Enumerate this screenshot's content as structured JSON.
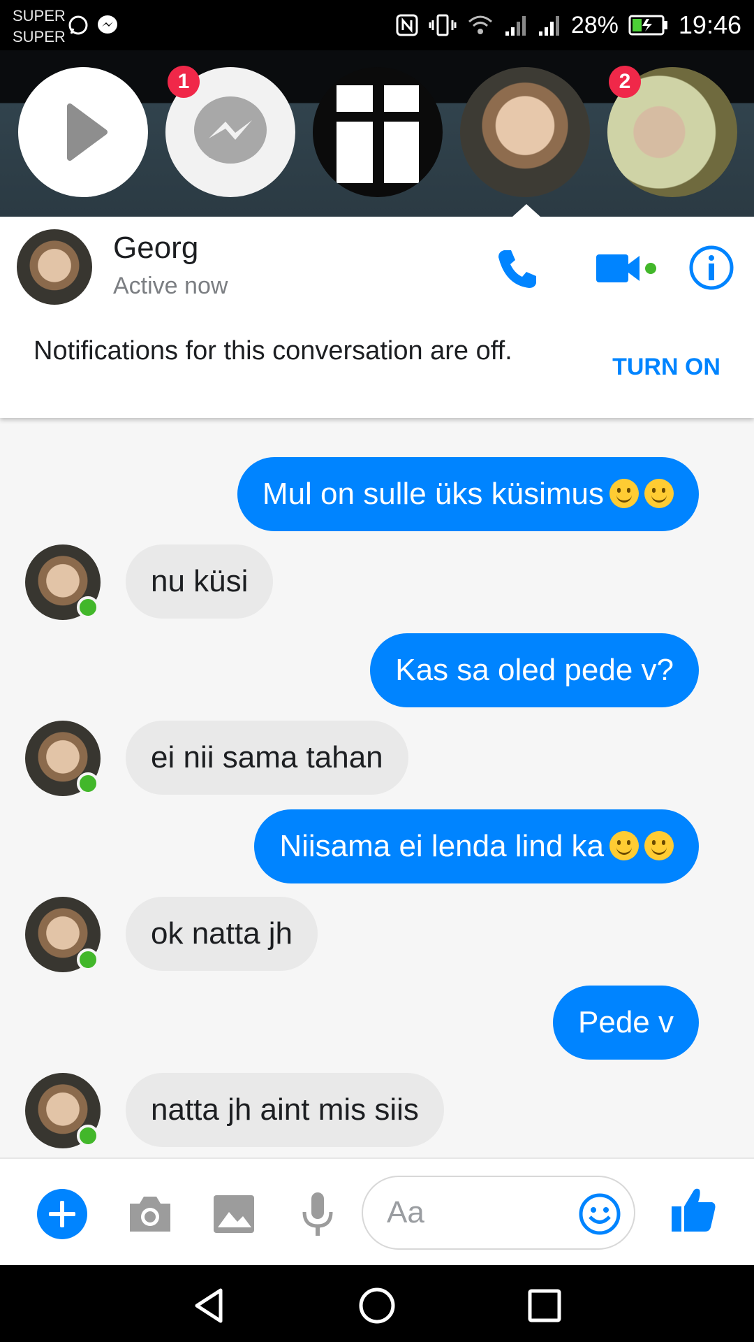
{
  "status_bar": {
    "carrier_line1": "SUPER",
    "carrier_line2": "SUPER",
    "battery_percent": "28%",
    "time": "19:46",
    "icons": [
      "whatsapp-icon",
      "messenger-icon",
      "nfc-icon",
      "vibrate-icon",
      "wifi-icon",
      "signal-icon",
      "signal-icon",
      "battery-icon"
    ]
  },
  "chat_heads": {
    "items": [
      {
        "name": "play",
        "badge": ""
      },
      {
        "name": "messenger",
        "badge": "1"
      },
      {
        "name": "cross",
        "badge": ""
      },
      {
        "name": "georg",
        "badge": ""
      },
      {
        "name": "contact",
        "badge": "2"
      }
    ]
  },
  "conversation": {
    "name": "Georg",
    "status": "Active now",
    "notification_text": "Notifications for this conversation are off.",
    "notification_action": "TURN ON",
    "colors": {
      "accent": "#0084ff",
      "online": "#42b72a",
      "incoming_bubble": "#e9e9e9"
    }
  },
  "messages": [
    {
      "dir": "in",
      "text": "",
      "emojis": 0
    },
    {
      "dir": "out",
      "text": "Mul on sulle üks küsimus",
      "emojis": 2
    },
    {
      "dir": "in",
      "text": "nu küsi",
      "emojis": 0
    },
    {
      "dir": "out",
      "text": "Kas sa oled pede v?",
      "emojis": 0
    },
    {
      "dir": "in",
      "text": "ei nii sama tahan",
      "emojis": 0
    },
    {
      "dir": "out",
      "text": "Niisama ei lenda lind ka",
      "emojis": 2
    },
    {
      "dir": "in",
      "text": "ok natta jh",
      "emojis": 0
    },
    {
      "dir": "out",
      "text": "Pede v",
      "emojis": 0
    },
    {
      "dir": "in",
      "text": "natta jh aint mis siis",
      "emojis": 0
    }
  ],
  "composer": {
    "placeholder": "Aa",
    "buttons": [
      "plus-icon",
      "camera-icon",
      "image-icon",
      "microphone-icon",
      "emoji-icon",
      "thumbs-up-icon"
    ]
  }
}
